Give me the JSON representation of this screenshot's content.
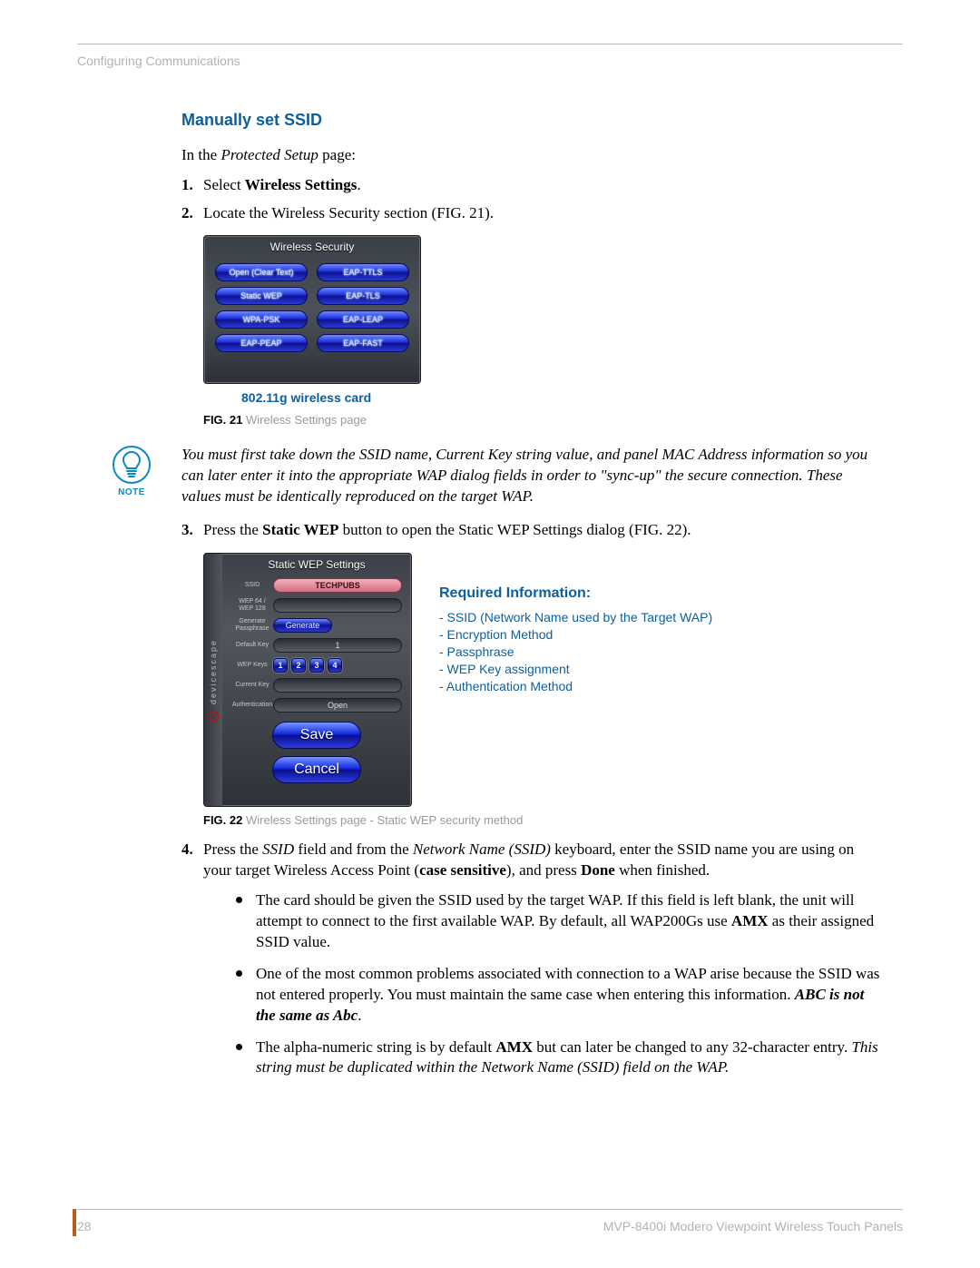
{
  "running_head": "Configuring Communications",
  "section_title": "Manually set SSID",
  "intro_prefix": "In the ",
  "intro_italic": "Protected Setup",
  "intro_suffix": " page:",
  "steps": {
    "s1": {
      "num": "1.",
      "pre": "Select ",
      "bold": "Wireless Settings",
      "post": "."
    },
    "s2": {
      "num": "2.",
      "text": "Locate the Wireless Security section (FIG. 21)."
    },
    "s3": {
      "num": "3.",
      "pre": "Press the ",
      "bold": "Static WEP",
      "post": " button to open the Static WEP Settings dialog (FIG. 22)."
    },
    "s4": {
      "num": "4.",
      "p1a": "Press the ",
      "p1b": "SSID",
      "p1c": " field and from the ",
      "p1d": "Network Name (SSID)",
      "p1e": " keyboard, enter the SSID name you are using on your target Wireless Access Point (",
      "p1f": "case sensitive",
      "p1g": "), and press ",
      "p1h": "Done",
      "p1i": " when finished."
    }
  },
  "fig21": {
    "title": "Wireless Security",
    "buttons": [
      "Open (Clear Text)",
      "EAP-TTLS",
      "Static WEP",
      "EAP-TLS",
      "WPA-PSK",
      "EAP-LEAP",
      "EAP-PEAP",
      "EAP-FAST"
    ],
    "sub": "802.11g wireless card",
    "caption_label": "FIG. 21",
    "caption_text": "  Wireless Settings page"
  },
  "note": {
    "label": "NOTE",
    "text": "You must first take down the SSID name, Current Key string value, and panel MAC Address information so you can later enter it into the appropriate WAP dialog fields in order to \"sync-up\" the secure connection. These values must be identically reproduced on the target WAP."
  },
  "fig22": {
    "title": "Static WEP Settings",
    "side_text": "devicescape",
    "fields": {
      "ssid": {
        "label": "SSID",
        "value": "TECHPUBS"
      },
      "wep": {
        "label": "WEP 64 / WEP 128",
        "value": ""
      },
      "gen": {
        "label": "Generate Passphrase",
        "value": "Generate"
      },
      "default_key": {
        "label": "Default Key",
        "value": "1"
      },
      "wep_keys": {
        "label": "WEP Keys",
        "keys": [
          "1",
          "2",
          "3",
          "4"
        ]
      },
      "current_key": {
        "label": "Current Key",
        "value": ""
      },
      "auth": {
        "label": "Authentication",
        "value": "Open"
      }
    },
    "save": "Save",
    "cancel": "Cancel",
    "caption_label": "FIG. 22",
    "caption_text": "  Wireless Settings page - Static WEP security method"
  },
  "required_info": {
    "heading": "Required Information:",
    "items": [
      "- SSID (Network Name used by the Target WAP)",
      "- Encryption Method",
      "- Passphrase",
      "- WEP Key assignment",
      "- Authentication Method"
    ]
  },
  "bullets": {
    "b1a": "The card should be given the SSID used by the target WAP. If this field is left blank, the unit will attempt to connect to the first available WAP. By default, all WAP200Gs use ",
    "b1b": "AMX",
    "b1c": " as their assigned SSID value.",
    "b2a": "One of the most common problems associated with connection to a WAP arise because the SSID was not entered properly. You must maintain the same case when entering this information. ",
    "b2b": "ABC is not the same as Abc",
    "b2c": ".",
    "b3a": "The alpha-numeric string is by default ",
    "b3b": "AMX",
    "b3c": " but can later be changed to any 32-character entry. ",
    "b3d": "This string must be duplicated within the Network Name (SSID) field on the WAP."
  },
  "footer": {
    "page_no": "28",
    "doc": "MVP-8400i Modero Viewpoint Wireless Touch Panels"
  }
}
